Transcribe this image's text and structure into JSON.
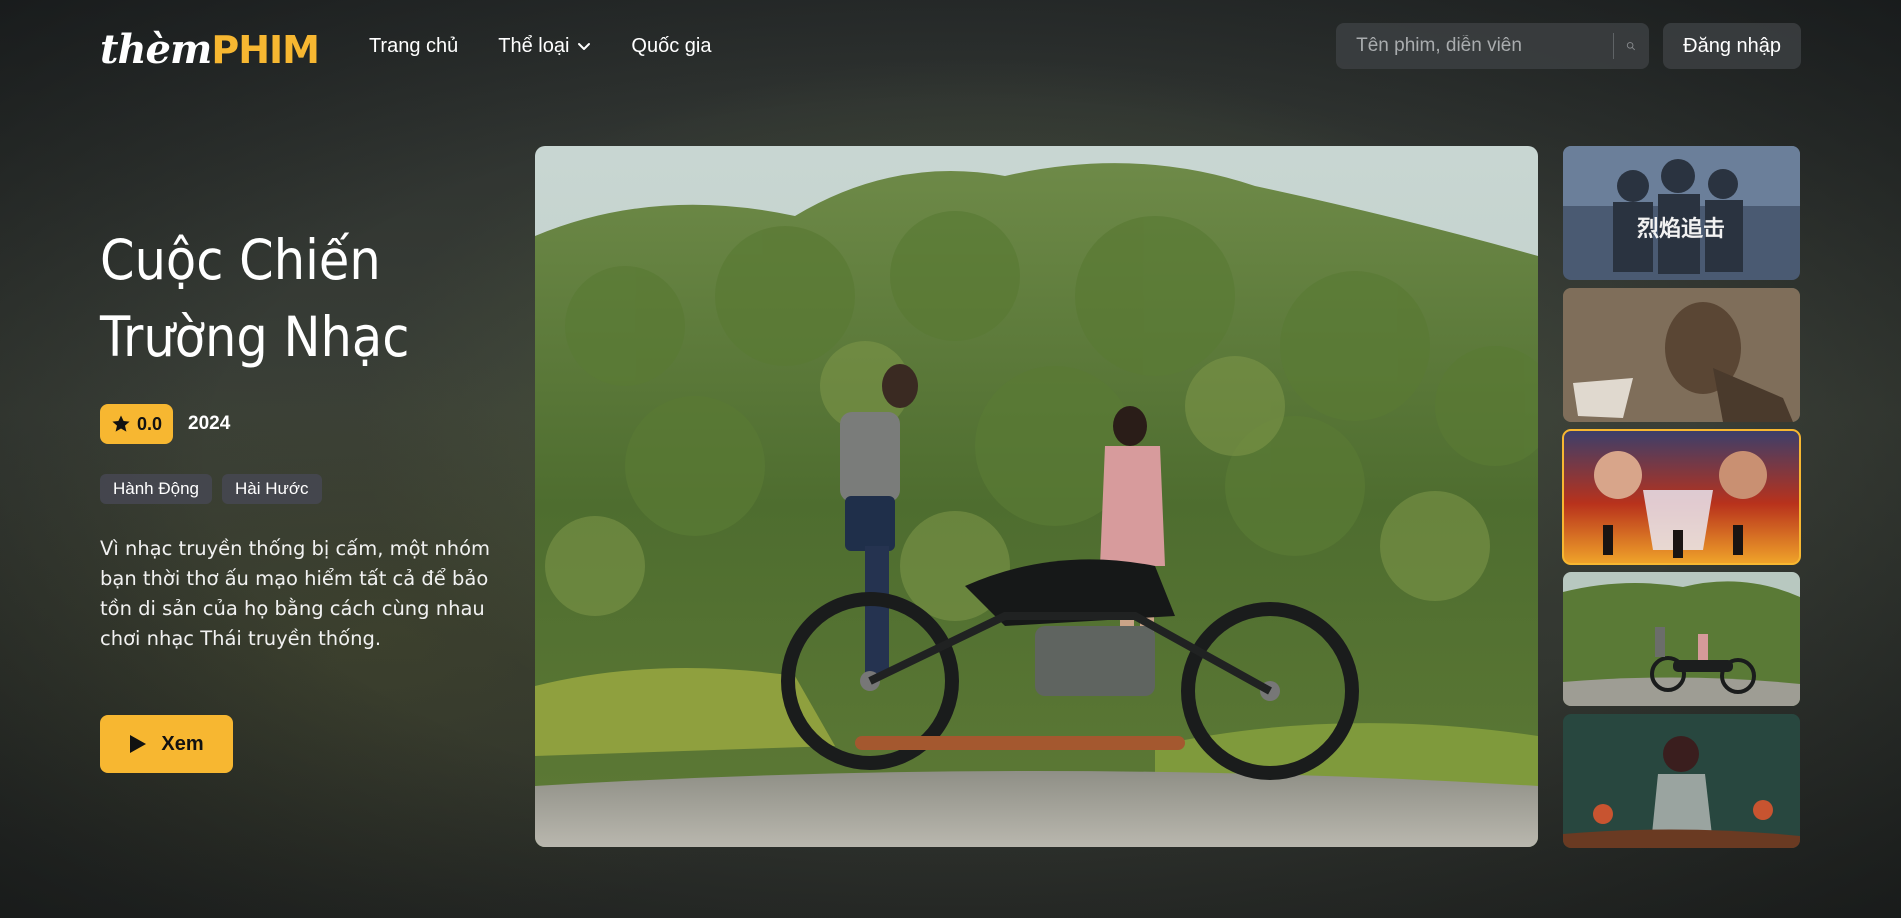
{
  "logo": {
    "script": "thèm",
    "bold": "PHIM"
  },
  "nav": {
    "home": "Trang chủ",
    "genre": "Thể loại",
    "country": "Quốc gia"
  },
  "search": {
    "placeholder": "Tên phim, diễn viên",
    "icon": "search-icon"
  },
  "login_label": "Đăng nhập",
  "featured": {
    "title": "Cuộc Chiến Trường Nhạc",
    "rating": "0.0",
    "year": "2024",
    "genres": [
      "Hành Động",
      "Hài Hước"
    ],
    "description": "Vì nhạc truyền thống bị cấm, một nhóm bạn thời thơ ấu mạo hiểm tất cả để bảo tồn di sản của họ bằng cách cùng nhau chơi nhạc Thái truyền thống.",
    "watch_label": "Xem"
  },
  "thumbnails": {
    "count": 5,
    "active_index": 3,
    "overlay_texts": [
      "烈焰追击",
      "",
      "",
      "",
      ""
    ]
  },
  "colors": {
    "accent": "#f7b731",
    "tag_bg": "#464852"
  }
}
